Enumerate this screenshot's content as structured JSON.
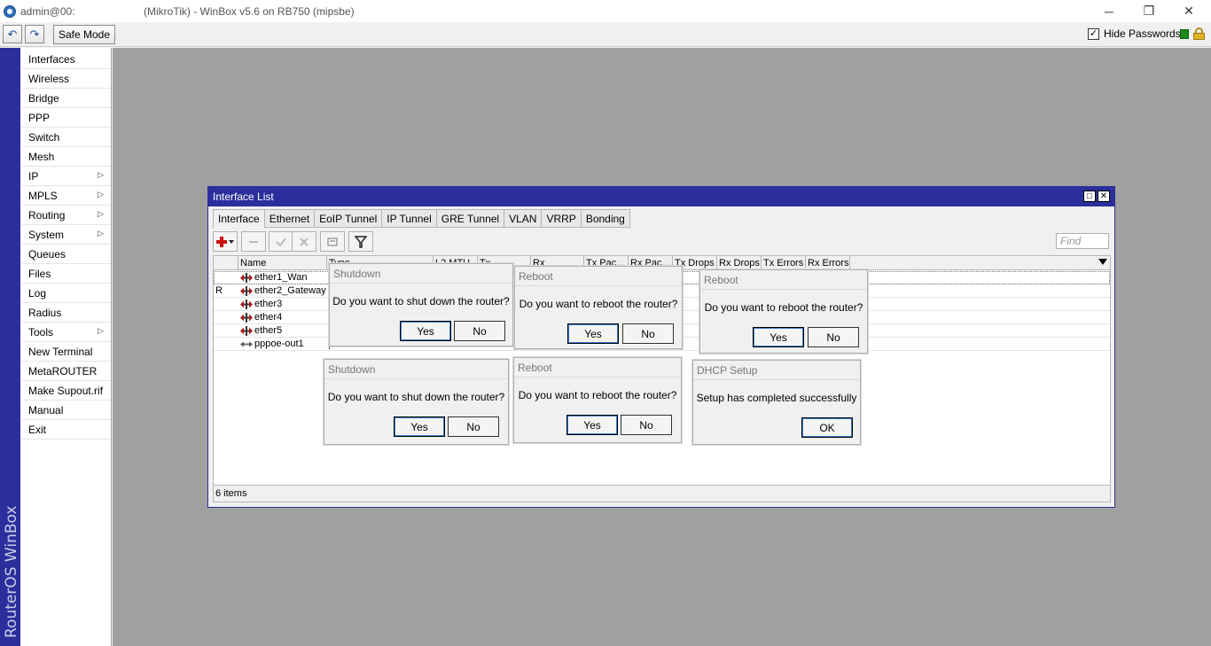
{
  "titlebar": {
    "user": "admin@00:",
    "title": "(MikroTik) - WinBox v5.6 on RB750 (mipsbe)",
    "min": "─",
    "max": "❐",
    "close": "✕"
  },
  "toolbar": {
    "undo": "↶",
    "redo": "↷",
    "safe_mode": "Safe Mode",
    "hide_passwords": "Hide Passwords",
    "hide_passwords_checked": "✓"
  },
  "brand": "RouterOS WinBox",
  "menu": [
    {
      "label": "Interfaces",
      "arrow": ""
    },
    {
      "label": "Wireless",
      "arrow": ""
    },
    {
      "label": "Bridge",
      "arrow": ""
    },
    {
      "label": "PPP",
      "arrow": ""
    },
    {
      "label": "Switch",
      "arrow": ""
    },
    {
      "label": "Mesh",
      "arrow": ""
    },
    {
      "label": "IP",
      "arrow": "▷"
    },
    {
      "label": "MPLS",
      "arrow": "▷"
    },
    {
      "label": "Routing",
      "arrow": "▷"
    },
    {
      "label": "System",
      "arrow": "▷"
    },
    {
      "label": "Queues",
      "arrow": ""
    },
    {
      "label": "Files",
      "arrow": ""
    },
    {
      "label": "Log",
      "arrow": ""
    },
    {
      "label": "Radius",
      "arrow": ""
    },
    {
      "label": "Tools",
      "arrow": "▷"
    },
    {
      "label": "New Terminal",
      "arrow": ""
    },
    {
      "label": "MetaROUTER",
      "arrow": ""
    },
    {
      "label": "Make Supout.rif",
      "arrow": ""
    },
    {
      "label": "Manual",
      "arrow": ""
    },
    {
      "label": "Exit",
      "arrow": ""
    }
  ],
  "interface_list": {
    "title": "Interface List",
    "max_btn": "□",
    "close_btn": "✕",
    "tabs": [
      "Interface",
      "Ethernet",
      "EoIP Tunnel",
      "IP Tunnel",
      "GRE Tunnel",
      "VLAN",
      "VRRP",
      "Bonding"
    ],
    "find_placeholder": "Find",
    "columns": [
      "Name",
      "Type",
      "L2 MTU",
      "Tx",
      "Rx",
      "Tx Pac...",
      "Rx Pac...",
      "Tx Drops",
      "Rx Drops",
      "Tx Errors",
      "Rx Errors"
    ],
    "rows": [
      {
        "flag": "",
        "name": "ether1_Wan"
      },
      {
        "flag": "R",
        "name": "ether2_Gateway"
      },
      {
        "flag": "",
        "name": "ether3"
      },
      {
        "flag": "",
        "name": "ether4"
      },
      {
        "flag": "",
        "name": "ether5"
      },
      {
        "flag": "",
        "name": "pppoe-out1"
      }
    ],
    "status": "6 items"
  },
  "dialogs": {
    "shutdown1": {
      "title": "Shutdown",
      "message": "Do you want to shut down the router?",
      "yes": "Yes",
      "no": "No"
    },
    "reboot1": {
      "title": "Reboot",
      "message": "Do you want to reboot the router?",
      "yes": "Yes",
      "no": "No"
    },
    "reboot2": {
      "title": "Reboot",
      "message": "Do you want to reboot the router?",
      "yes": "Yes",
      "no": "No"
    },
    "shutdown2": {
      "title": "Shutdown",
      "message": "Do you want to shut down the router?",
      "yes": "Yes",
      "no": "No"
    },
    "reboot3": {
      "title": "Reboot",
      "message": "Do you want to reboot the router?",
      "yes": "Yes",
      "no": "No"
    },
    "dhcp": {
      "title": "DHCP Setup",
      "message": "Setup has completed successfully",
      "ok": "OK"
    }
  },
  "colors": {
    "brand_bar": "#2a2f9c",
    "workspace": "#a0a0a0",
    "add_icon": "#cc1010",
    "safe_mode_indicator": "#1a8a1a"
  }
}
